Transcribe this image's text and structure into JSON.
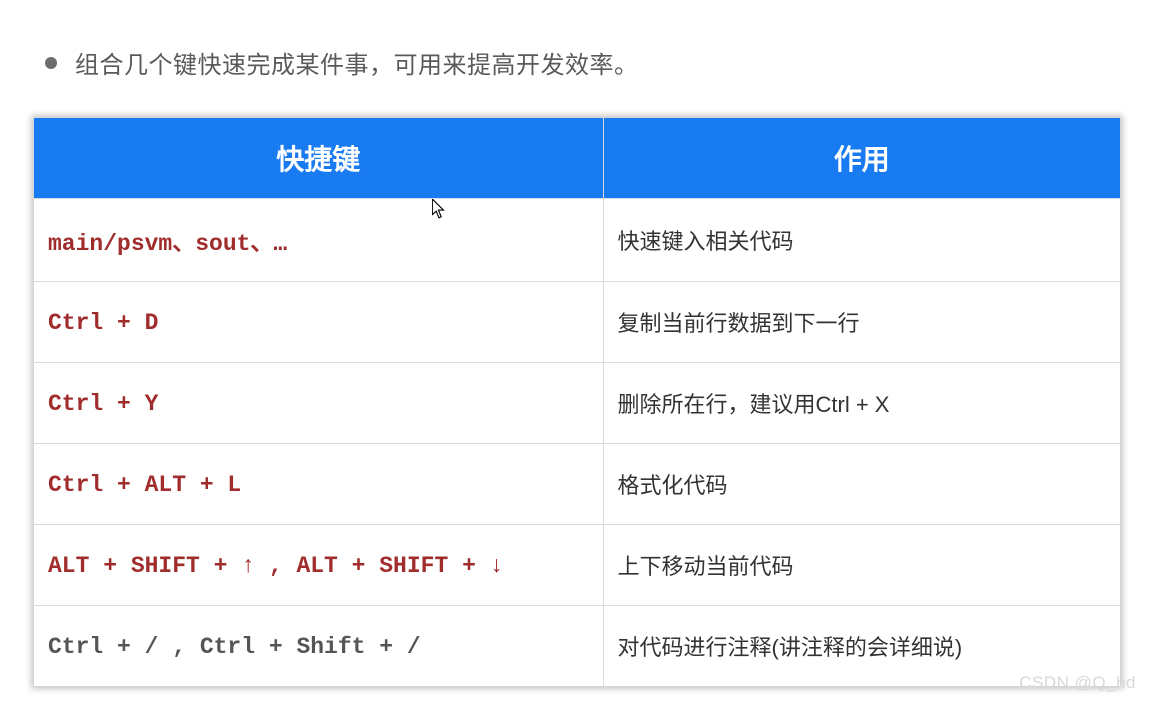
{
  "bullet": "组合几个键快速完成某件事，可用来提高开发效率。",
  "table": {
    "headers": {
      "shortcut": "快捷键",
      "purpose": "作用"
    },
    "rows": [
      {
        "shortcut": "main/psvm、sout、…",
        "purpose": "快速键入相关代码",
        "style": "sc"
      },
      {
        "shortcut": "Ctrl + D",
        "purpose": "复制当前行数据到下一行",
        "style": "sc"
      },
      {
        "shortcut": "Ctrl + Y",
        "purpose": "删除所在行，建议用Ctrl + X",
        "style": "sc"
      },
      {
        "shortcut": "Ctrl + ALT + L",
        "purpose": "格式化代码",
        "style": "sc"
      },
      {
        "shortcut": "ALT + SHIFT + ↑ , ALT + SHIFT + ↓",
        "purpose": "上下移动当前代码",
        "style": "sc"
      },
      {
        "shortcut": "Ctrl + / , Ctrl + Shift + /",
        "purpose": "对代码进行注释(讲注释的会详细说)",
        "style": "sc2"
      }
    ]
  },
  "watermark": "CSDN @Q_hd"
}
